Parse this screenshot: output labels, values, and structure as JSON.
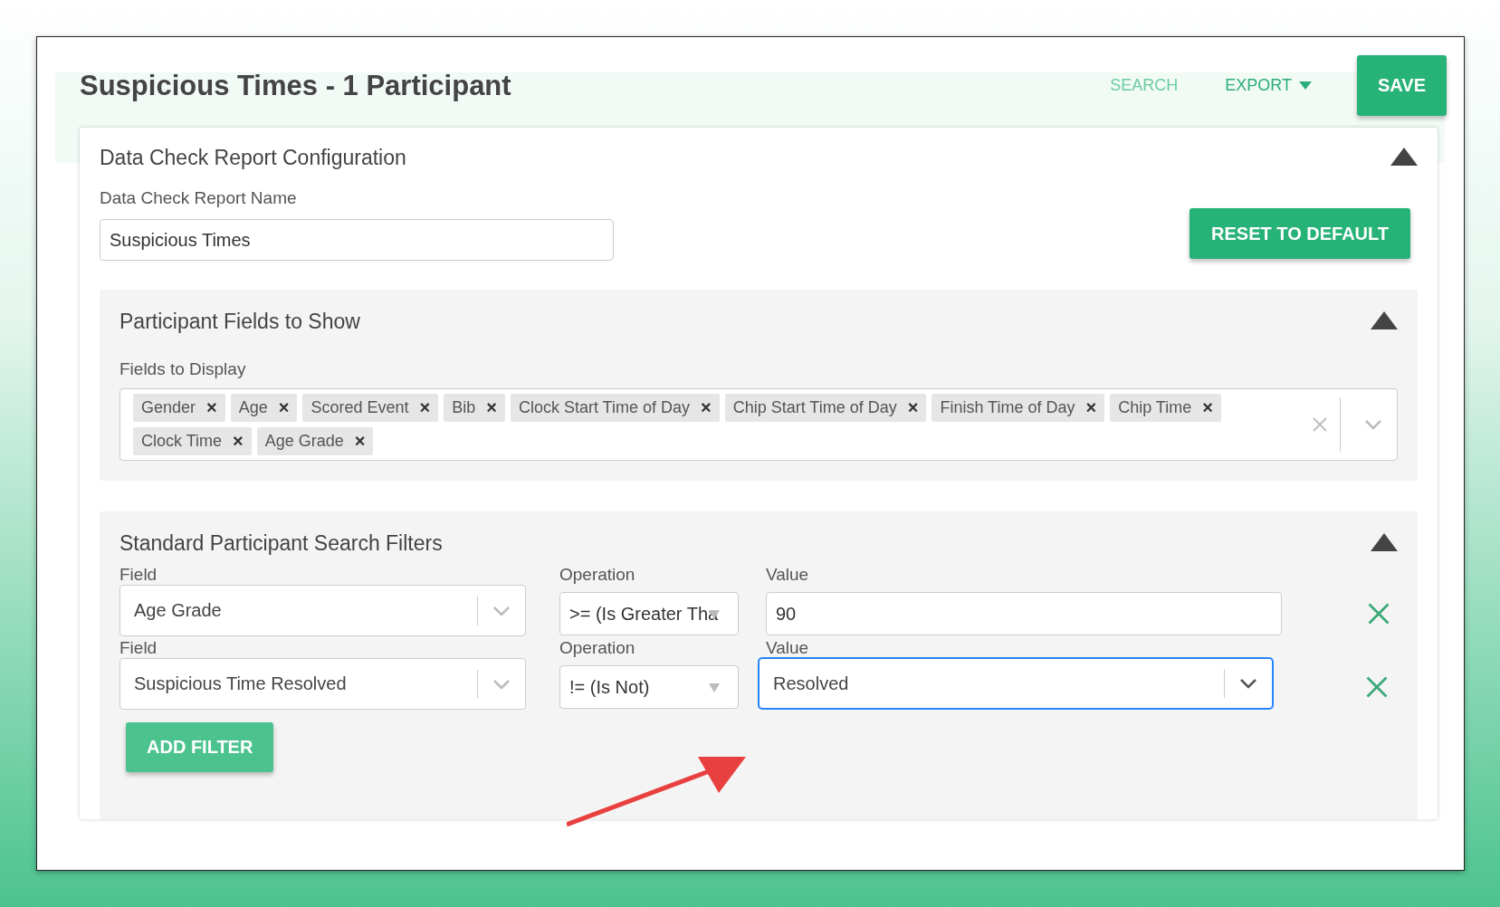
{
  "header": {
    "title": "Suspicious Times - 1 Participant",
    "actions": [
      {
        "label": "SEARCH",
        "kind": "link"
      },
      {
        "label": "EXPORT",
        "kind": "menu"
      }
    ],
    "save": "SAVE"
  },
  "config": {
    "title": "Data Check Report Configuration",
    "expanded": true,
    "name_label": "Data Check Report Name",
    "name_value": "Suspicious Times",
    "reset": "RESET TO DEFAULT"
  },
  "fields_section": {
    "title": "Participant Fields to Show",
    "expanded": true,
    "label": "Fields to Display",
    "tags": [
      "Gender",
      "Age",
      "Scored Event",
      "Bib",
      "Clock Start Time of Day",
      "Chip Start Time of Day",
      "Finish Time of Day",
      "Chip Time",
      "Clock Time",
      "Age Grade"
    ],
    "tag_remove": "×"
  },
  "filters_section": {
    "title": "Standard Participant Search Filters",
    "expanded": true,
    "filters": [
      {
        "field_label": "Field",
        "field": "Age Grade",
        "operation_label": "Operation",
        "operation": ">= (Is Greater Tha",
        "value_label": "Value",
        "value": "90",
        "kind": "input",
        "focused": false
      },
      {
        "field_label": "Field",
        "field": "Suspicious Time Resolved",
        "operation_label": "Operation",
        "operation": "!= (Is Not)",
        "value_label": "Value",
        "value": "Resolved",
        "kind": "select",
        "focused": true
      }
    ],
    "add": "ADD FILTER"
  }
}
